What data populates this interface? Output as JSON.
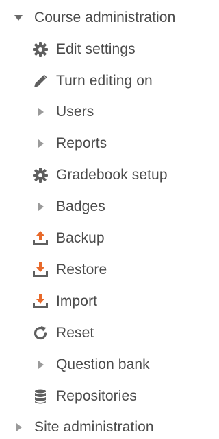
{
  "nav": {
    "course_admin": {
      "label": "Course administration",
      "icon": "caret-down-icon",
      "items": [
        {
          "label": "Edit settings",
          "icon": "gear-icon"
        },
        {
          "label": "Turn editing on",
          "icon": "pencil-icon"
        },
        {
          "label": "Users",
          "icon": "caret-right-icon"
        },
        {
          "label": "Reports",
          "icon": "caret-right-icon"
        },
        {
          "label": "Gradebook setup",
          "icon": "gear-icon"
        },
        {
          "label": "Badges",
          "icon": "caret-right-icon"
        },
        {
          "label": "Backup",
          "icon": "upload-icon"
        },
        {
          "label": "Restore",
          "icon": "download-icon"
        },
        {
          "label": "Import",
          "icon": "download-icon"
        },
        {
          "label": "Reset",
          "icon": "reset-icon"
        },
        {
          "label": "Question bank",
          "icon": "caret-right-icon"
        },
        {
          "label": "Repositories",
          "icon": "database-icon"
        }
      ]
    },
    "site_admin": {
      "label": "Site administration",
      "icon": "caret-right-icon"
    }
  },
  "colors": {
    "text": "#4b4b4b",
    "icon": "#5f5f5f",
    "caret": "#9a9a9a",
    "backup_arrow": "#e8692a"
  }
}
